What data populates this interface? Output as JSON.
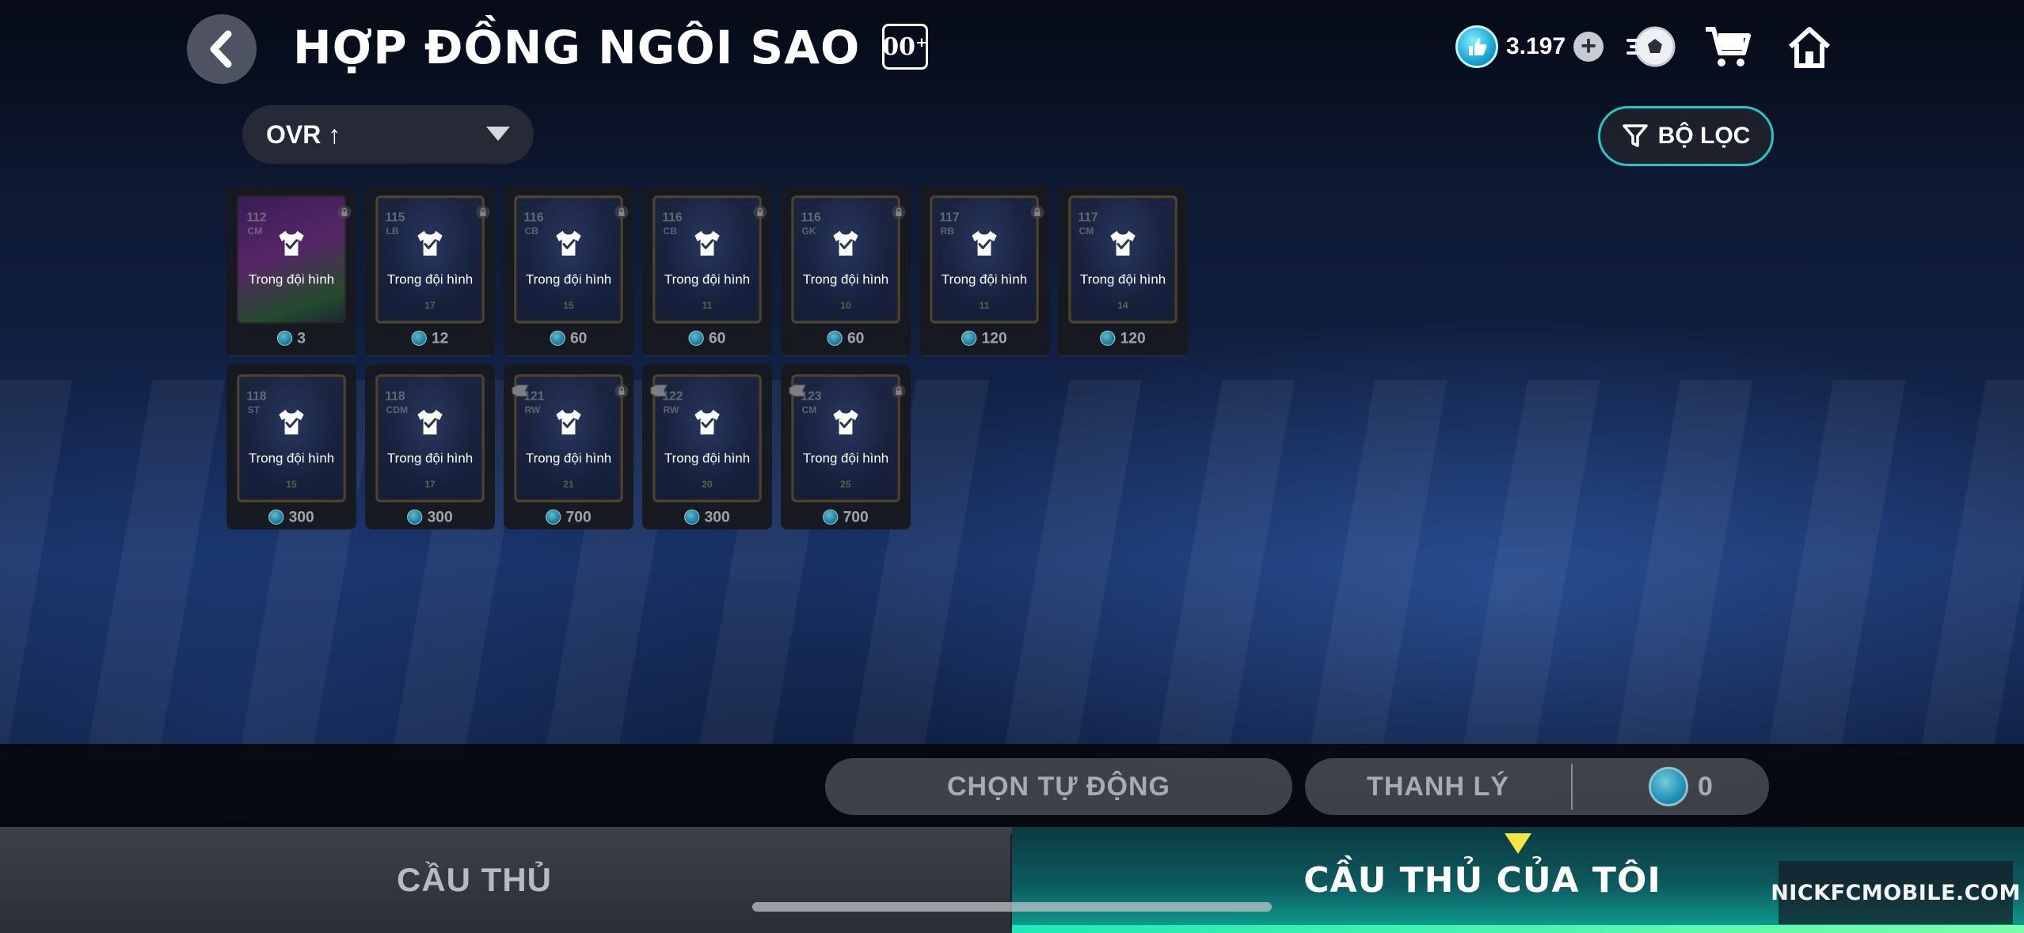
{
  "header": {
    "title": "HỢP ĐỒNG NGÔI SAO",
    "title_badge": "00⁺",
    "currency_value": "3.197",
    "currency_plus": "+"
  },
  "sort": {
    "label": "OVR ↑"
  },
  "filter": {
    "label": "BỘ LỌC"
  },
  "cards": [
    {
      "ovr": "112",
      "pos": "CM",
      "level": "",
      "status": "Trong đội hình",
      "price": "3",
      "special": true,
      "grade": false,
      "locked": true
    },
    {
      "ovr": "115",
      "pos": "LB",
      "level": "17",
      "status": "Trong đội hình",
      "price": "12",
      "special": false,
      "grade": false,
      "locked": true
    },
    {
      "ovr": "116",
      "pos": "CB",
      "level": "15",
      "status": "Trong đội hình",
      "price": "60",
      "special": false,
      "grade": false,
      "locked": true
    },
    {
      "ovr": "116",
      "pos": "CB",
      "level": "11",
      "status": "Trong đội hình",
      "price": "60",
      "special": false,
      "grade": false,
      "locked": true
    },
    {
      "ovr": "116",
      "pos": "GK",
      "level": "10",
      "status": "Trong đội hình",
      "price": "60",
      "special": false,
      "grade": false,
      "locked": true
    },
    {
      "ovr": "117",
      "pos": "RB",
      "level": "11",
      "status": "Trong đội hình",
      "price": "120",
      "special": false,
      "grade": false,
      "locked": true
    },
    {
      "ovr": "117",
      "pos": "CM",
      "level": "14",
      "status": "Trong đội hình",
      "price": "120",
      "special": false,
      "grade": false,
      "locked": false
    },
    {
      "ovr": "118",
      "pos": "ST",
      "level": "15",
      "status": "Trong đội hình",
      "price": "300",
      "special": false,
      "grade": false,
      "locked": false
    },
    {
      "ovr": "118",
      "pos": "CDM",
      "level": "17",
      "status": "Trong đội hình",
      "price": "300",
      "special": false,
      "grade": false,
      "locked": false
    },
    {
      "ovr": "121",
      "pos": "RW",
      "level": "21",
      "status": "Trong đội hình",
      "price": "700",
      "special": false,
      "grade": true,
      "locked": true
    },
    {
      "ovr": "122",
      "pos": "RW",
      "level": "20",
      "status": "Trong đội hình",
      "price": "300",
      "special": false,
      "grade": true,
      "locked": false
    },
    {
      "ovr": "123",
      "pos": "CM",
      "level": "25",
      "status": "Trong đội hình",
      "price": "700",
      "special": false,
      "grade": true,
      "locked": true
    }
  ],
  "actions": {
    "auto_select": "CHỌN TỰ ĐỘNG",
    "sell": "THANH LÝ",
    "sell_amount": "0"
  },
  "tabs": {
    "players": "CẦU THỦ",
    "my_players": "CẦU THỦ CỦA TÔI"
  },
  "watermark": "NICKFCMOBILE.COM",
  "colors": {
    "accent_teal": "#27c6c6",
    "coin_blue": "#1aa6d4",
    "tab_active_green": "#1de9b6",
    "indicator_yellow": "#f5e642"
  }
}
